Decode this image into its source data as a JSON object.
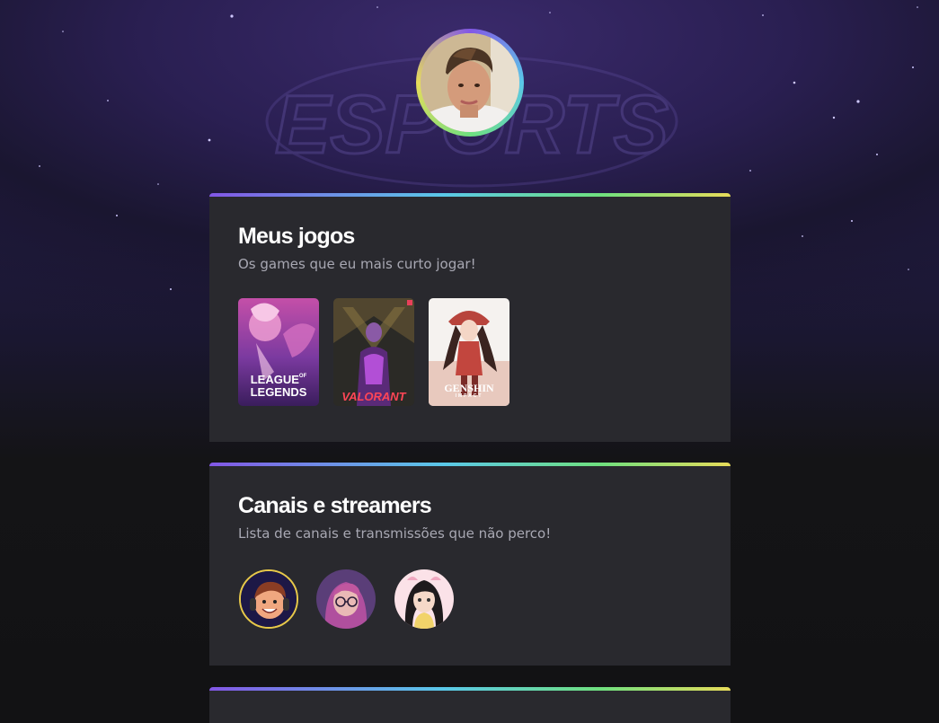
{
  "profile": {
    "avatar_icon": "profile-photo"
  },
  "background": {
    "watermark_text": "ESPORTS"
  },
  "colors": {
    "accent_purple": "#8257e6",
    "accent_blue": "#5ac8e8",
    "accent_green": "#6fe07f",
    "accent_yellow": "#e7dc5a",
    "card_bg": "#29292e",
    "subtitle": "#a8a8b3"
  },
  "games_section": {
    "title": "Meus jogos",
    "subtitle": "Os games que eu mais curto jogar!",
    "games": [
      {
        "name": "League of Legends",
        "logo_line1": "LEAGUE",
        "logo_of": "OF",
        "logo_line2": "LEGENDS"
      },
      {
        "name": "Valorant",
        "logo": "VALORANT"
      },
      {
        "name": "Genshin Impact",
        "logo_line1": "GENSHIN",
        "logo_line2": "IMPACT"
      }
    ]
  },
  "channels_section": {
    "title": "Canais e streamers",
    "subtitle": "Lista de canais e transmissões que não perco!",
    "channels": [
      {
        "icon": "streamer-avatar-boy-headset"
      },
      {
        "icon": "streamer-avatar-girl-glasses"
      },
      {
        "icon": "streamer-avatar-girl-black-hair"
      }
    ]
  }
}
